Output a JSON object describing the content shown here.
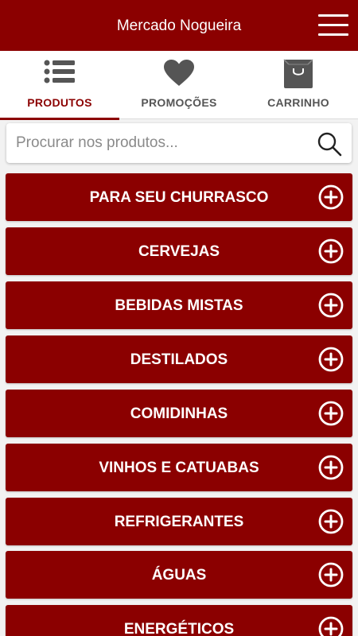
{
  "header": {
    "title": "Mercado Nogueira",
    "menu_icon": "hamburger-menu-icon"
  },
  "tabs": [
    {
      "label": "PRODUTOS",
      "icon": "list-icon",
      "active": true
    },
    {
      "label": "PROMOÇÕES",
      "icon": "heart-icon",
      "active": false
    },
    {
      "label": "CARRINHO",
      "icon": "shopping-bag-icon",
      "active": false
    }
  ],
  "search": {
    "placeholder": "Procurar nos produtos...",
    "value": "",
    "icon": "search-icon"
  },
  "categories": [
    {
      "label": "PARA SEU CHURRASCO"
    },
    {
      "label": "CERVEJAS"
    },
    {
      "label": "BEBIDAS MISTAS"
    },
    {
      "label": "DESTILADOS"
    },
    {
      "label": "COMIDINHAS"
    },
    {
      "label": "VINHOS E CATUABAS"
    },
    {
      "label": "REFRIGERANTES"
    },
    {
      "label": "ÁGUAS"
    },
    {
      "label": "ENERGÉTICOS"
    }
  ],
  "colors": {
    "brand": "#8b0000",
    "tab_icon": "#555555",
    "background": "#f2f2f2"
  }
}
